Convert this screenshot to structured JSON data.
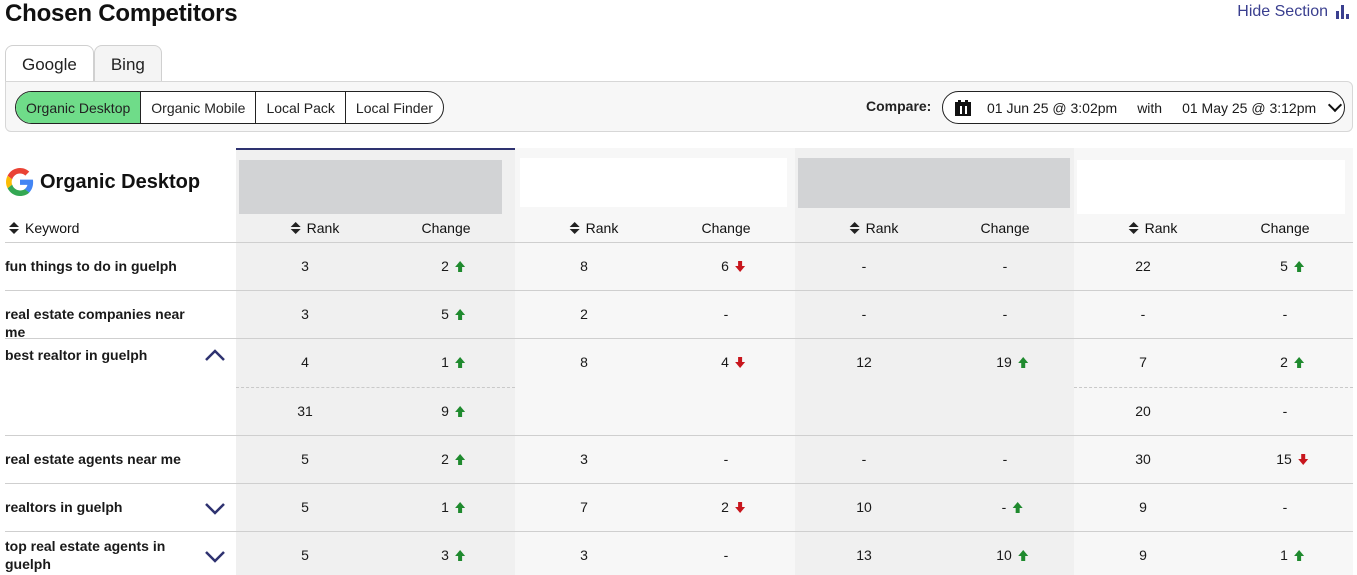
{
  "page": {
    "title": "Chosen Competitors",
    "hide_section_label": "Hide Section",
    "hide_section_icon": "bar-chart-icon"
  },
  "engine_tabs": [
    {
      "label": "Google",
      "active": true
    },
    {
      "label": "Bing",
      "active": false
    }
  ],
  "result_types": [
    {
      "label": "Organic Desktop",
      "active": true
    },
    {
      "label": "Organic Mobile",
      "active": false
    },
    {
      "label": "Local Pack",
      "active": false
    },
    {
      "label": "Local Finder",
      "active": false
    }
  ],
  "compare": {
    "label": "Compare:",
    "icon": "calendar-icon",
    "from": "01 Jun 25 @ 3:02pm",
    "with_label": "with",
    "to": "01 May 25 @ 3:12pm"
  },
  "table": {
    "section_title": "Organic Desktop",
    "section_icon": "google-g-icon",
    "keyword_header": "Keyword",
    "rank_header": "Rank",
    "change_header": "Change",
    "colors": {
      "up": "#1f8a2e",
      "down": "#c8161d",
      "active_tab": "#6fdc89",
      "accent": "#2e3270"
    },
    "rows": [
      {
        "keyword": "fun things to do in guelph",
        "cells": [
          [
            "3",
            "2",
            "up"
          ],
          [
            "8",
            "6",
            "down"
          ],
          [
            "-",
            "-",
            ""
          ],
          [
            "22",
            "5",
            "up"
          ]
        ]
      },
      {
        "keyword": "real estate companies near me",
        "cells": [
          [
            "3",
            "5",
            "up"
          ],
          [
            "2",
            "-",
            ""
          ],
          [
            "-",
            "-",
            ""
          ],
          [
            "-",
            "-",
            ""
          ]
        ]
      },
      {
        "keyword": "best realtor in guelph",
        "expanded": true,
        "cells": [
          [
            "4",
            "1",
            "up"
          ],
          [
            "8",
            "4",
            "down"
          ],
          [
            "12",
            "19",
            "up"
          ],
          [
            "7",
            "2",
            "up"
          ]
        ],
        "subcells": [
          [
            "31",
            "9",
            "up"
          ],
          [
            "",
            "",
            ""
          ],
          [
            "",
            "",
            ""
          ],
          [
            "20",
            "-",
            ""
          ]
        ]
      },
      {
        "keyword": "real estate agents near me",
        "cells": [
          [
            "5",
            "2",
            "up"
          ],
          [
            "3",
            "-",
            ""
          ],
          [
            "-",
            "-",
            ""
          ],
          [
            "30",
            "15",
            "down"
          ]
        ]
      },
      {
        "keyword": "realtors in guelph",
        "collapsed": true,
        "cells": [
          [
            "5",
            "1",
            "up"
          ],
          [
            "7",
            "2",
            "down"
          ],
          [
            "10",
            "-",
            "up"
          ],
          [
            "9",
            "-",
            ""
          ]
        ]
      },
      {
        "keyword": "top real estate agents in guelph",
        "collapsed": true,
        "cells": [
          [
            "5",
            "3",
            "up"
          ],
          [
            "3",
            "-",
            ""
          ],
          [
            "13",
            "10",
            "up"
          ],
          [
            "9",
            "1",
            "up"
          ]
        ]
      }
    ]
  }
}
